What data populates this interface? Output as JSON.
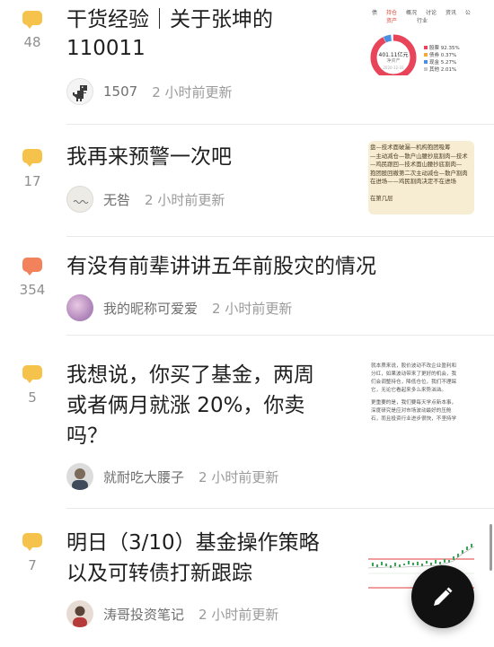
{
  "posts": [
    {
      "reply_count": "48",
      "reply_color": "#f5c24b",
      "title_line1": "干货经验｜关于张坤的",
      "title_line2": "110011",
      "author": "1507",
      "time": "2 小时前更新",
      "avatar_icon": "dinosaur-avatar-icon",
      "thumb": {
        "tabs": [
          "债",
          "持仓",
          "概况",
          "讨论",
          "资讯",
          "公"
        ],
        "tab_sub": [
          "资产",
          "行业"
        ],
        "donut_value": "401.11亿元",
        "donut_label": "净资产",
        "donut_date": "2020-12-31",
        "legend": [
          {
            "name": "股票",
            "value": "92.35%",
            "color": "#e8445a"
          },
          {
            "name": "债券",
            "value": "0.37%",
            "color": "#f3a93c"
          },
          {
            "name": "现金",
            "value": "5.27%",
            "color": "#4a90e2"
          },
          {
            "name": "其他",
            "value": "2.01%",
            "color": "#c9c9c9"
          }
        ]
      }
    },
    {
      "reply_count": "17",
      "reply_color": "#f5c24b",
      "title_line1": "我再来预警一次吧",
      "author": "无咎",
      "time": "2 小时前更新",
      "avatar_icon": "handwriting-avatar-icon",
      "thumb": {
        "lines": [
          "盘—技术面破漏—机构抱团吸筹",
          "—主动减仓—散户山腰抄底割肉—技术",
          "—鸡民跟回—技术面山腰抄底割肉—",
          "抱团股回撤第二次主动减仓—散户割肉",
          "在进场——鸡民割肉决定不在进场",
          "",
          "在第几层"
        ]
      }
    },
    {
      "reply_count": "354",
      "reply_color": "#f2825c",
      "title_line1": "有没有前辈讲讲五年前股灾的情况",
      "author": "我的昵称可爱爱",
      "time": "2 小时前更新",
      "avatar_icon": "purple-avatar-icon"
    },
    {
      "reply_count": "5",
      "reply_color": "#f5c24b",
      "title_line1": "我想说，你买了基金，两周",
      "title_line2": "或者俩月就涨 20%，你卖",
      "title_line3": "吗？",
      "author": "就耐吃大腰子",
      "time": "2 小时前更新",
      "avatar_icon": "person-avatar-icon",
      "thumb": {
        "lines": [
          "就本质来说，股价波动不改企业盈利和",
          "分红，如果波动带来了更好的机会，我",
          "们会调整持仓，降低仓位，我们不理睬",
          "它，无论它看起来多么来势汹汹。",
          "",
          "更重要的是，我们要每天学点新本事，",
          "深度研究是应对市场波动最好的压舱",
          "石，而且投资行业进步很快，不坚持学"
        ]
      }
    },
    {
      "reply_count": "7",
      "reply_color": "#f5c24b",
      "title_line1": "明日（3/10）基金操作策略",
      "title_line2": "以及可转债打新跟踪",
      "author": "涛哥投资笔记",
      "time": "2 小时前更新",
      "avatar_icon": "photo-avatar-icon"
    }
  ],
  "fab": {
    "icon": "pencil-icon"
  }
}
